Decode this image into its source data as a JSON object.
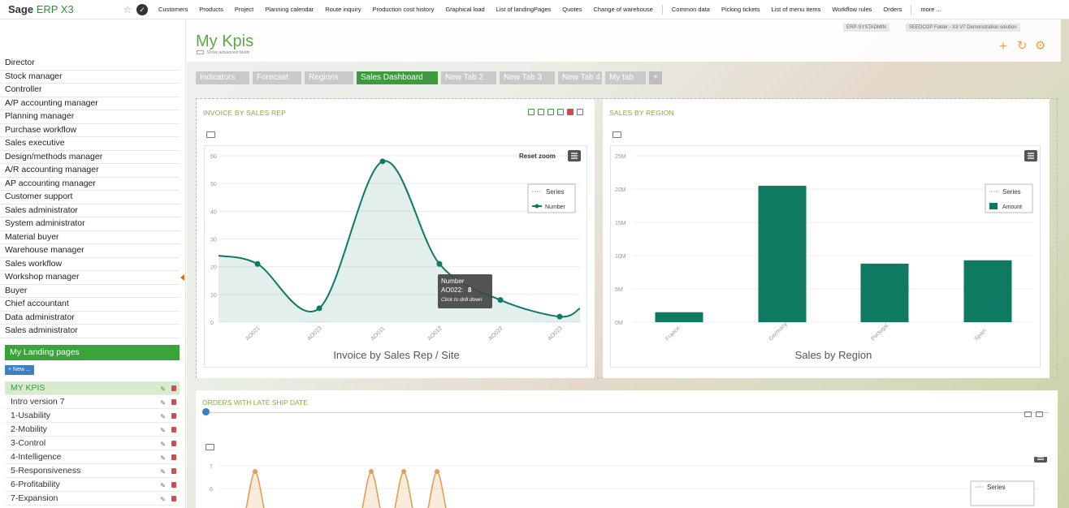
{
  "app": {
    "brand": "Sage",
    "product": "ERP X3"
  },
  "topmenu": [
    "Customers",
    "Products",
    "Project",
    "Planning calendar",
    "Route inquiry",
    "Production cost history",
    "Graphical load",
    "List of landingPages",
    "Quotes",
    "Change of warehouse",
    "Common data",
    "Picking tickets",
    "List of menu items",
    "Workflow rules",
    "Orders",
    "more ..."
  ],
  "sidebar": {
    "roles": [
      "Director",
      "Stock manager",
      "Controller",
      "A/P accounting manager",
      "Planning manager",
      "Purchase workflow",
      "Sales executive",
      "Design/methods manager",
      "A/R accounting manager",
      "AP accounting manager",
      "Customer support",
      "Sales administrator",
      "System administrator",
      "Material buyer",
      "Warehouse manager",
      "Sales workflow",
      "Workshop manager",
      "Buyer",
      "Chief accountant",
      "Data administrator",
      "Sales administrator"
    ],
    "landing_header": "My Landing pages",
    "new_button": "+ New ...",
    "landing_pages": [
      "MY KPIS",
      "Intro version 7",
      "1-Usability",
      "2-Mobility",
      "3-Control",
      "4-Intelligence",
      "5-Responsiveness",
      "6-Profitability",
      "7-Expansion"
    ],
    "active_index": 0
  },
  "header": {
    "title": "My Kpis",
    "advanced": "Show advanced fields",
    "user_chip": "ERP-SYSTADMIN",
    "folder_chip": "SEEDCOP Folder - X3 V7 Demonstration solution"
  },
  "tabs": [
    {
      "label": "Indicators",
      "active": false
    },
    {
      "label": "Forecast",
      "active": false
    },
    {
      "label": "Regions",
      "active": false
    },
    {
      "label": "Sales Dashboard",
      "active": true
    },
    {
      "label": "New Tab 2",
      "active": false
    },
    {
      "label": "New Tab 3",
      "active": false
    },
    {
      "label": "New Tab 4",
      "active": false
    },
    {
      "label": "My tab",
      "active": false
    },
    {
      "label": "+",
      "active": false
    }
  ],
  "panels": {
    "invoice": {
      "title": "INVOICE BY SALES REP",
      "reset_zoom": "Reset zoom"
    },
    "region": {
      "title": "SALES BY REGION"
    },
    "late": {
      "title": "ORDERS WITH LATE SHIP DATE"
    }
  },
  "tooltip": {
    "series": "Number",
    "category": "AO022:",
    "value": "8",
    "hint": "Click to drill down"
  },
  "colors": {
    "accent_green": "#3f9a3f",
    "chart_teal": "#0f7a62",
    "title_green": "#7fae3e"
  },
  "chart_data": [
    {
      "type": "area",
      "title": "Invoice by Sales Rep / Site",
      "categories": [
        "AO021",
        "AO023",
        "AO011",
        "AO012",
        "AO022",
        "AO023"
      ],
      "ylim": [
        0,
        60
      ],
      "yticks": [
        "0",
        "10",
        "20",
        "30",
        "40",
        "50",
        "60"
      ],
      "series": [
        {
          "name": "Number",
          "values": [
            21,
            5,
            58,
            21,
            8,
            2
          ]
        }
      ],
      "legend_title": "Series",
      "legend_position": "top-right",
      "grid": true
    },
    {
      "type": "bar",
      "title": "Sales by Region",
      "categories": [
        "France",
        "Germany",
        "Portugal",
        "Spain"
      ],
      "ylim": [
        0,
        25000000
      ],
      "yticks": [
        "0M",
        "5M",
        "10M",
        "15M",
        "20M",
        "25M"
      ],
      "series": [
        {
          "name": "Amount",
          "values": [
            1500000,
            20500000,
            8800000,
            9300000
          ]
        }
      ],
      "legend_title": "Series",
      "legend_position": "top-right",
      "grid": true
    },
    {
      "type": "area",
      "title": "",
      "ylim": [
        0,
        7
      ],
      "yticks": [
        "6",
        "7"
      ],
      "legend_title": "Series"
    }
  ]
}
